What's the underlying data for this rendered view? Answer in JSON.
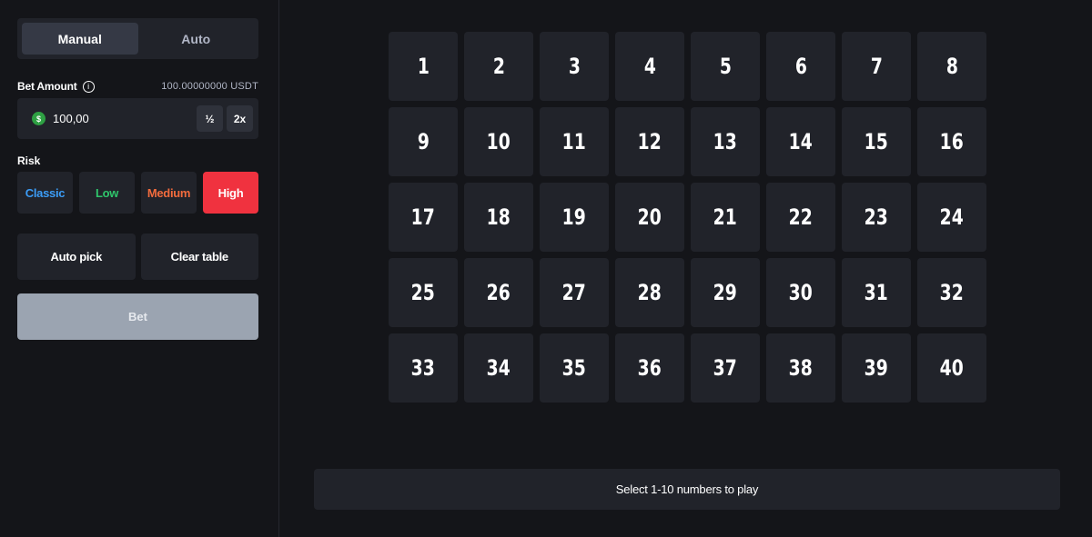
{
  "mode_toggle": {
    "manual": "Manual",
    "auto": "Auto",
    "active": "manual"
  },
  "bet": {
    "label": "Bet Amount",
    "info_icon": "info-icon",
    "balance": "100.00000000 USDT",
    "currency_icon": "dollar-coin-icon",
    "currency_symbol": "$",
    "value": "100,00",
    "half_label": "½",
    "double_label": "2x"
  },
  "risk": {
    "label": "Risk",
    "options": [
      "Classic",
      "Low",
      "Medium",
      "High"
    ],
    "selected": "High",
    "colors": {
      "Classic": "#3b9cf6",
      "Low": "#2fc56b",
      "Medium": "#f26b3d",
      "High": "#f0323f"
    }
  },
  "actions": {
    "auto_pick": "Auto pick",
    "clear_table": "Clear table"
  },
  "bet_button": "Bet",
  "board": {
    "numbers": [
      "1",
      "2",
      "3",
      "4",
      "5",
      "6",
      "7",
      "8",
      "9",
      "10",
      "11",
      "12",
      "13",
      "14",
      "15",
      "16",
      "17",
      "18",
      "19",
      "20",
      "21",
      "22",
      "23",
      "24",
      "25",
      "26",
      "27",
      "28",
      "29",
      "30",
      "31",
      "32",
      "33",
      "34",
      "35",
      "36",
      "37",
      "38",
      "39",
      "40"
    ]
  },
  "status": "Select 1-10 numbers to play"
}
